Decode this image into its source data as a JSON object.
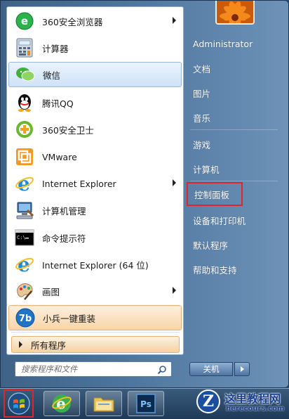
{
  "programs": [
    {
      "label": "360安全浏览器",
      "icon": "360-browser-icon",
      "submenu": true
    },
    {
      "label": "计算器",
      "icon": "calculator-icon",
      "submenu": false
    },
    {
      "label": "微信",
      "icon": "wechat-icon",
      "submenu": false,
      "state": "hover"
    },
    {
      "label": "腾讯QQ",
      "icon": "qq-icon",
      "submenu": false
    },
    {
      "label": "360安全卫士",
      "icon": "360-safeguard-icon",
      "submenu": false
    },
    {
      "label": "VMware",
      "icon": "vmware-icon",
      "submenu": false
    },
    {
      "label": "Internet Explorer",
      "icon": "ie-icon",
      "submenu": true
    },
    {
      "label": "计算机管理",
      "icon": "computer-management-icon",
      "submenu": false
    },
    {
      "label": "命令提示符",
      "icon": "cmd-icon",
      "submenu": false
    },
    {
      "label": "Internet Explorer (64 位)",
      "icon": "ie-icon",
      "submenu": false
    },
    {
      "label": "画图",
      "icon": "paint-icon",
      "submenu": true
    },
    {
      "label": "小兵一键重装",
      "icon": "xiaobing-icon",
      "submenu": false,
      "state": "highlighted"
    }
  ],
  "all_programs": "所有程序",
  "search": {
    "placeholder": "搜索程序和文件"
  },
  "right_links": [
    {
      "label": "Administrator"
    },
    {
      "label": "文档"
    },
    {
      "label": "图片"
    },
    {
      "label": "音乐"
    },
    {
      "label": "游戏"
    },
    {
      "label": "计算机"
    },
    {
      "label": "控制面板",
      "annotated": true
    },
    {
      "label": "设备和打印机"
    },
    {
      "label": "默认程序"
    },
    {
      "label": "帮助和支持"
    }
  ],
  "shutdown": {
    "label": "关机"
  },
  "taskbar": {
    "start": "start-orb-icon",
    "pinned": [
      "ie-icon",
      "file-explorer-icon",
      "photoshop-icon"
    ],
    "photoshop_label": "Ps"
  },
  "watermark": {
    "letter": "Z",
    "title": "这里教程网",
    "url": "herecours.com"
  },
  "colors": {
    "annotation": "#e1262a",
    "hover_blue": "#cfe2f8",
    "highlight_orange": "#f7d6a9"
  }
}
